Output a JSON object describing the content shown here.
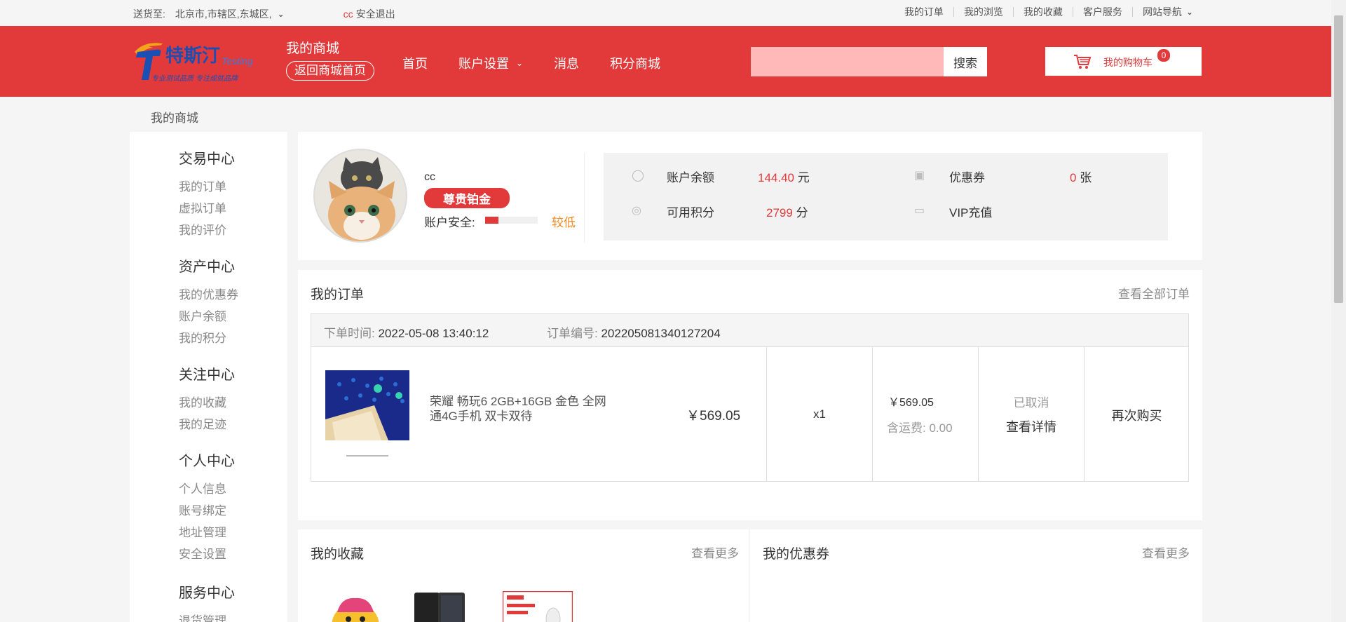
{
  "topbar": {
    "ship_to_label": "送货至:",
    "address": "北京市,市辖区,东城区,",
    "username": "cc",
    "logout": "安全退出",
    "links": [
      "我的订单",
      "我的浏览",
      "我的收藏",
      "客户服务",
      "网站导航"
    ]
  },
  "header": {
    "logo_text": "特斯汀",
    "logo_sub": "Testing",
    "logo_slogan": "专业测试品质 专注成就品牌",
    "mall_title": "我的商城",
    "back_home": "返回商城首页",
    "nav": [
      "首页",
      "账户设置",
      "消息",
      "积分商城"
    ],
    "search_placeholder": "",
    "search_button": "搜索",
    "cart_label": "我的购物车",
    "cart_count": "0",
    "accent": "#e23a3a"
  },
  "breadcrumb": "我的商城",
  "sidebar": {
    "groups": [
      {
        "title": "交易中心",
        "links": [
          "我的订单",
          "虚拟订单",
          "我的评价"
        ]
      },
      {
        "title": "资产中心",
        "links": [
          "我的优惠券",
          "账户余额",
          "我的积分"
        ]
      },
      {
        "title": "关注中心",
        "links": [
          "我的收藏",
          "我的足迹"
        ]
      },
      {
        "title": "个人中心",
        "links": [
          "个人信息",
          "账号绑定",
          "地址管理",
          "安全设置"
        ]
      },
      {
        "title": "服务中心",
        "links": [
          "退货管理"
        ]
      }
    ]
  },
  "profile": {
    "name": "cc",
    "level_badge": "尊贵铂金",
    "security_label": "账户安全:",
    "security_level": "较低",
    "security_fraction": 0.25,
    "balance_label": "账户余额",
    "balance_value": "144.40",
    "balance_unit": "元",
    "coupon_label": "优惠券",
    "coupon_value": "0",
    "coupon_unit": "张",
    "points_label": "可用积分",
    "points_value": "2799",
    "points_unit": "分",
    "vip_label": "VIP充值"
  },
  "orders": {
    "title": "我的订单",
    "view_all": "查看全部订单",
    "time_label": "下单时间:",
    "time_value": "2022-05-08 13:40:12",
    "no_label": "订单编号:",
    "no_value": "202205081340127204",
    "product_name": "荣耀 畅玩6 2GB+16GB 金色 全网通4G手机 双卡双待",
    "unit_price": "￥569.05",
    "quantity": "x1",
    "paid": "￥569.05",
    "shipping_label": "含运费:",
    "shipping_value": "0.00",
    "status": "已取消",
    "detail": "查看详情",
    "rebuy": "再次购买"
  },
  "favorites": {
    "title": "我的收藏",
    "more": "查看更多"
  },
  "coupons": {
    "title": "我的优惠券",
    "more": "查看更多"
  }
}
